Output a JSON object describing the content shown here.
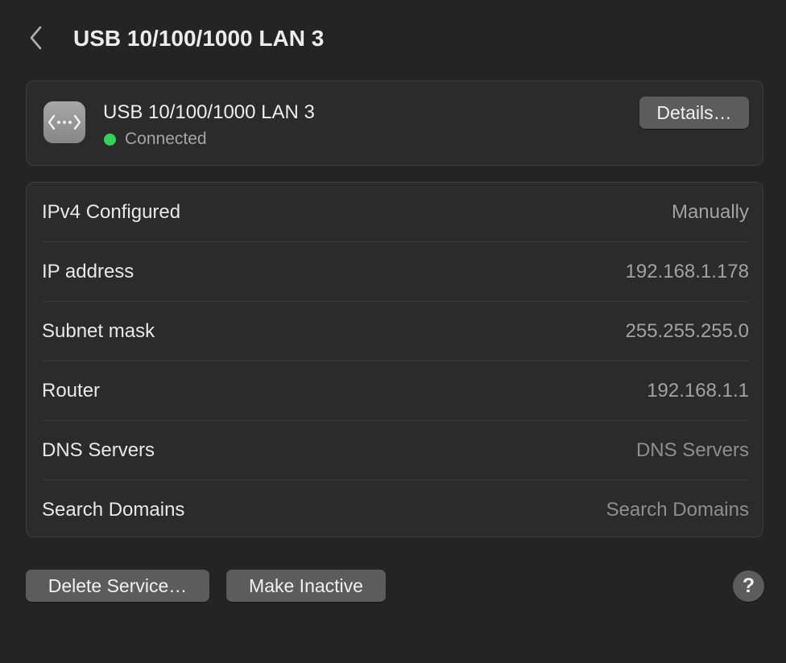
{
  "header": {
    "title": "USB 10/100/1000 LAN 3",
    "back_icon": "chevron-left-icon"
  },
  "service": {
    "name": "USB 10/100/1000 LAN 3",
    "icon": "network-ethernet-icon",
    "status": "Connected",
    "status_color": "#32d158",
    "details_label": "Details…"
  },
  "info_rows": [
    {
      "label": "IPv4 Configured",
      "value": "Manually"
    },
    {
      "label": "IP address",
      "value": "192.168.1.178"
    },
    {
      "label": "Subnet mask",
      "value": "255.255.255.0"
    },
    {
      "label": "Router",
      "value": "192.168.1.1"
    },
    {
      "label": "DNS Servers",
      "value": "DNS Servers"
    },
    {
      "label": "Search Domains",
      "value": "Search Domains"
    }
  ],
  "footer": {
    "delete_label": "Delete Service…",
    "inactive_label": "Make Inactive",
    "help_label": "?"
  }
}
